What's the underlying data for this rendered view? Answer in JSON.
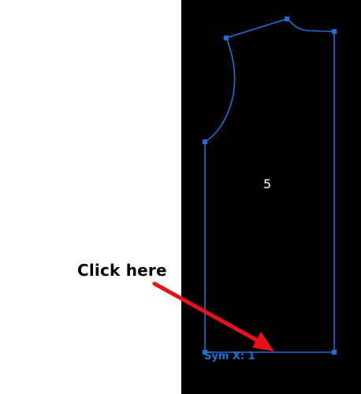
{
  "annotation": {
    "instruction_text": "Click here",
    "arrow_color": "#e8101a"
  },
  "canvas": {
    "background_color": "#000000",
    "pattern_piece": {
      "number_label": "5",
      "sym_label": "Sym X: 1",
      "outline_color": "#1e6fd9",
      "label_color": "#ffffff"
    }
  }
}
